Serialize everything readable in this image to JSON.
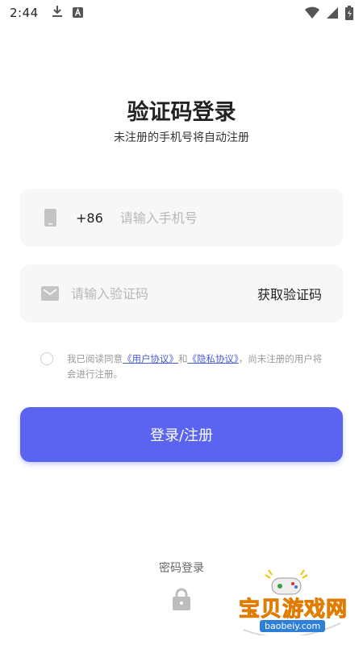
{
  "status_bar": {
    "time": "2:44",
    "icons": [
      "download-icon",
      "a-badge-icon",
      "wifi-icon",
      "signal-icon",
      "battery-icon"
    ]
  },
  "header": {
    "title": "验证码登录",
    "subtitle": "未注册的手机号将自动注册"
  },
  "phone_field": {
    "country_code": "+86",
    "placeholder": "请输入手机号",
    "icon": "phone-icon"
  },
  "code_field": {
    "placeholder": "请输入验证码",
    "get_code_label": "获取验证码",
    "icon": "message-icon"
  },
  "agreement": {
    "prefix": "我已阅读同意",
    "user_agreement": "《用户协议》",
    "and": "和",
    "privacy_policy": "《隐私协议》",
    "suffix": "，尚未注册的用户将会进行注册。"
  },
  "login_button": {
    "label": "登录/注册"
  },
  "password_login": {
    "label": "密码登录",
    "icon": "lock-icon"
  },
  "watermark": {
    "text": "宝贝游戏网",
    "url": "baobeiy.com"
  },
  "colors": {
    "accent": "#5a64f0",
    "link": "#4a5bd6",
    "field_bg": "#f7f7f7"
  }
}
